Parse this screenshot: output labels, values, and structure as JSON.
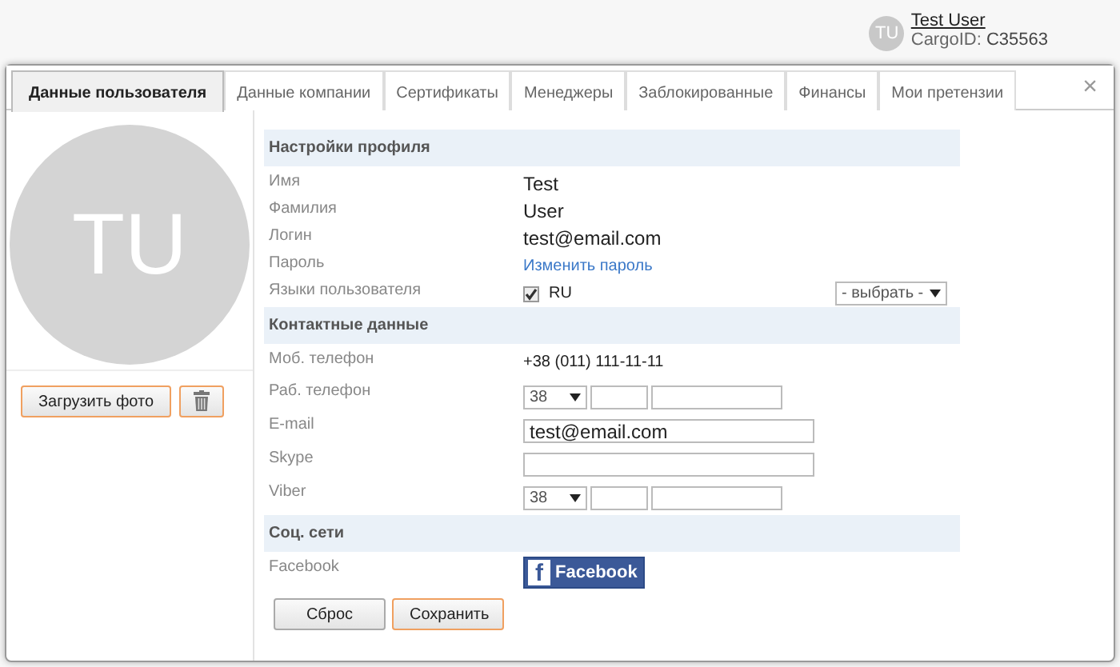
{
  "user_menu": {
    "initials": "TU",
    "name": "Test User",
    "cargo_label": "CargoID:",
    "cargo_id": "C35563"
  },
  "tabs": [
    {
      "label": "Данные пользователя",
      "selected": true
    },
    {
      "label": "Данные компании",
      "selected": false
    },
    {
      "label": "Сертификаты",
      "selected": false
    },
    {
      "label": "Менеджеры",
      "selected": false
    },
    {
      "label": "Заблокированные",
      "selected": false
    },
    {
      "label": "Финансы",
      "selected": false
    },
    {
      "label": "Мои претензии",
      "selected": false
    }
  ],
  "close": "×",
  "profile": {
    "initials": "TU",
    "upload_button": "Загрузить фото"
  },
  "sections": [
    {
      "title": "Настройки профиля",
      "rows": [
        {
          "kind": "text",
          "label": "Имя",
          "value": "Test"
        },
        {
          "kind": "text",
          "label": "Фамилия",
          "value": "User"
        },
        {
          "kind": "text",
          "label": "Логин",
          "value": "test@email.com"
        },
        {
          "kind": "link",
          "label": "Пароль",
          "value": "Изменить пароль"
        },
        {
          "kind": "language",
          "label": "Языки пользователя",
          "option": "RU",
          "checked": true,
          "select": "- выбрать -"
        }
      ]
    },
    {
      "title": "Контактные данные",
      "rows": [
        {
          "kind": "small",
          "label": "Моб. телефон",
          "value": "+38 (011) 111-11-11"
        },
        {
          "kind": "phone",
          "label": "Раб. телефон",
          "code": "38"
        },
        {
          "kind": "input",
          "label": "E-mail",
          "value": "test@email.com"
        },
        {
          "kind": "input",
          "label": "Skype"
        },
        {
          "kind": "phone",
          "label": "Viber",
          "code": "38"
        }
      ]
    },
    {
      "title": "Соц. сети",
      "rows": [
        {
          "kind": "social",
          "label": "Facebook",
          "glyph": "f",
          "value": "Facebook"
        }
      ]
    }
  ],
  "buttons": [
    {
      "label": "Сброс",
      "primary": false
    },
    {
      "label": "Сохранить",
      "primary": true
    }
  ]
}
